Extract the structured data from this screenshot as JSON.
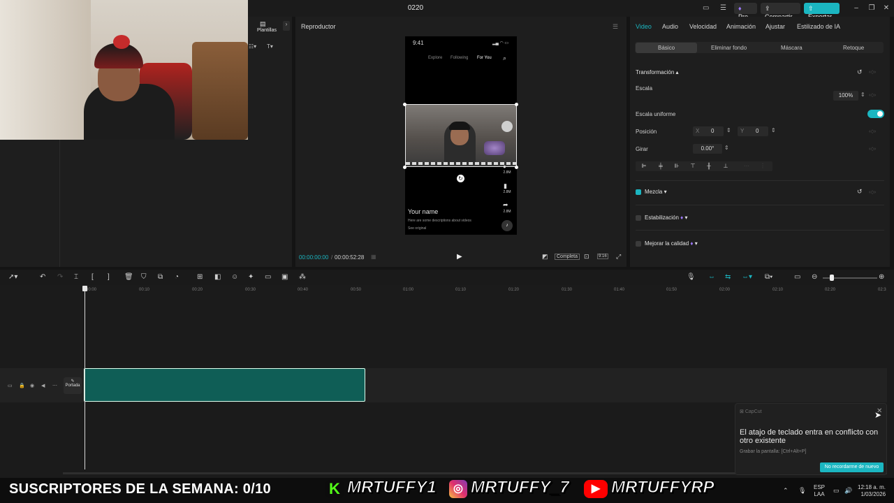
{
  "window": {
    "project_title": "0220",
    "pro_label": "Pro",
    "share_label": "Compartir",
    "export_label": "Exportar"
  },
  "media_panel": {
    "templates_tab": "Plantillas"
  },
  "player": {
    "title": "Reproductor",
    "current_time": "00:00:00:00",
    "total_time": "00:00:52:28",
    "full_label": "Completa",
    "ratio_label": "9:16",
    "phone": {
      "status_time": "9:41",
      "nav": [
        "Explore",
        "Following",
        "For You"
      ],
      "name": "Your name",
      "description": "Here are some descriptions about videos",
      "see_original": "See original",
      "counts": [
        "2.8M",
        "2.8M",
        "2.8M"
      ]
    }
  },
  "properties": {
    "tabs": [
      "Video",
      "Audio",
      "Velocidad",
      "Animación",
      "Ajustar",
      "Estilizado de IA"
    ],
    "subtabs": [
      "Básico",
      "Eliminar fondo",
      "Máscara",
      "Retoque"
    ],
    "transform_label": "Transformación",
    "scale_label": "Escala",
    "scale_value": "100%",
    "uniform_scale_label": "Escala uniforme",
    "uniform_scale_on": true,
    "position_label": "Posición",
    "x_label": "X",
    "x_value": "0",
    "y_label": "Y",
    "y_value": "0",
    "rotate_label": "Girar",
    "rotate_value": "0.00°",
    "blend_label": "Mezcla",
    "stabilize_label": "Estabilización",
    "enhance_label": "Mejorar la calidad"
  },
  "timeline": {
    "ticks": [
      "00:00",
      "00:10",
      "00:20",
      "00:30",
      "00:40",
      "00:50",
      "01:00",
      "01:10",
      "01:20",
      "01:30",
      "01:40",
      "01:50",
      "02:00",
      "02:10",
      "02:20",
      "02:3"
    ],
    "cover_label": "Portada",
    "clip_color": "#0f5e56"
  },
  "notification": {
    "app": "CapCut",
    "message": "El atajo de teclado entra en conflicto con otro existente",
    "hint": "Grabar la pantalla: [Ctrl+Alt+P]",
    "button": "No recordarme de nuevo"
  },
  "overlay": {
    "subs_text": "SUSCRIPTORES DE LA SEMANA: 0/10",
    "kick": "MRTUFFY1",
    "instagram": "MRTUFFY_7",
    "youtube": "MRTUFFYRP"
  },
  "taskbar": {
    "lang1": "ESP",
    "lang2": "LAA",
    "time": "12:18 a. m.",
    "date": "1/03/2026"
  },
  "colors": {
    "accent": "#1bb6c1",
    "clip": "#0f5e56"
  }
}
